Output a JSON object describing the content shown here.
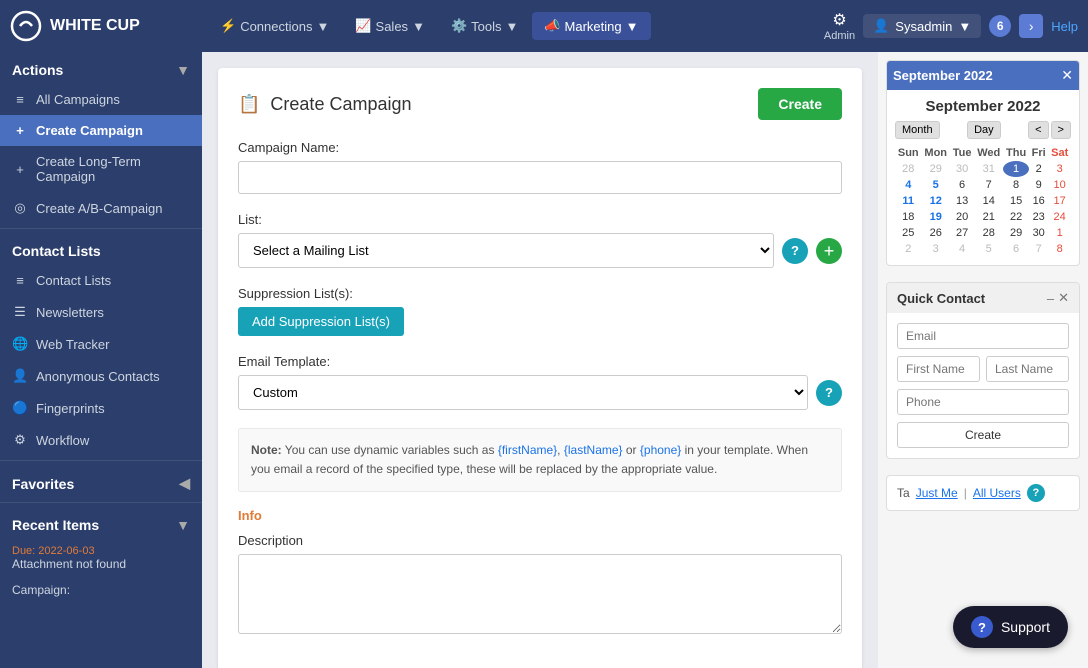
{
  "app": {
    "logo": "WHITE CUP",
    "nav": {
      "items": [
        {
          "id": "connections",
          "label": "Connections",
          "icon": "⚡",
          "active": false
        },
        {
          "id": "sales",
          "label": "Sales",
          "icon": "📈",
          "active": false
        },
        {
          "id": "tools",
          "label": "Tools",
          "icon": "⚙️",
          "active": false
        },
        {
          "id": "marketing",
          "label": "Marketing",
          "icon": "📣",
          "active": true
        }
      ],
      "admin_label": "Admin",
      "sysadmin_label": "Sysadmin",
      "badge_count": "6",
      "help_label": "Help"
    }
  },
  "sidebar": {
    "actions_label": "Actions",
    "items": [
      {
        "id": "all-campaigns",
        "label": "All Campaigns",
        "icon": "≡",
        "active": false
      },
      {
        "id": "create-campaign",
        "label": "Create Campaign",
        "icon": "+",
        "active": true
      },
      {
        "id": "create-longterm",
        "label": "Create Long-Term Campaign",
        "icon": "+",
        "active": false
      },
      {
        "id": "create-ab",
        "label": "Create A/B-Campaign",
        "icon": "◎",
        "active": false
      }
    ],
    "contact_lists_label": "Contact Lists",
    "contact_items": [
      {
        "id": "contact-lists",
        "label": "Contact Lists",
        "icon": "≡",
        "active": false
      },
      {
        "id": "newsletters",
        "label": "Newsletters",
        "icon": "☰",
        "active": false
      },
      {
        "id": "web-tracker",
        "label": "Web Tracker",
        "icon": "🌐",
        "active": false
      },
      {
        "id": "anonymous-contacts",
        "label": "Anonymous Contacts",
        "icon": "👤",
        "active": false
      },
      {
        "id": "fingerprints",
        "label": "Fingerprints",
        "icon": "🔵",
        "active": false
      },
      {
        "id": "workflow",
        "label": "Workflow",
        "icon": "⚙",
        "active": false
      }
    ],
    "favorites_label": "Favorites",
    "recent_items_label": "Recent Items",
    "recent": [
      {
        "due": "Due: 2022-06-03",
        "text": "Attachment not found"
      },
      {
        "label": "Campaign:",
        "value": ""
      }
    ]
  },
  "form": {
    "page_title": "Create Campaign",
    "create_button": "Create",
    "campaign_name_label": "Campaign Name:",
    "campaign_name_value": "",
    "list_label": "List:",
    "list_placeholder": "Select a Mailing List",
    "suppression_label": "Suppression List(s):",
    "suppression_button": "Add Suppression List(s)",
    "email_template_label": "Email Template:",
    "email_template_value": "Custom",
    "note_prefix": "Note:",
    "note_text": "You can use dynamic variables such as {firstName}, {lastName} or {phone} in your template. When you email a record of the specified type, these will be replaced by the appropriate value.",
    "info_label": "Info",
    "description_label": "Description",
    "description_value": ""
  },
  "calendar": {
    "header": "September 2022",
    "month_label": "September 2022",
    "month_btn": "Month",
    "day_btn": "Day",
    "days_of_week": [
      "Sun",
      "Mon",
      "Tue",
      "Wed",
      "Thu",
      "Fri",
      "Sat"
    ],
    "weeks": [
      [
        "28",
        "29",
        "30",
        "31",
        "1",
        "2",
        "3"
      ],
      [
        "4",
        "5",
        "6",
        "7",
        "8",
        "9",
        "10"
      ],
      [
        "11",
        "12",
        "13",
        "14",
        "15",
        "16",
        "17"
      ],
      [
        "18",
        "19",
        "20",
        "21",
        "22",
        "23",
        "24"
      ],
      [
        "25",
        "26",
        "27",
        "28",
        "29",
        "30",
        "1"
      ],
      [
        "2",
        "3",
        "4",
        "5",
        "6",
        "7",
        "8"
      ]
    ],
    "highlights": [
      "1",
      "11",
      "12",
      "19"
    ],
    "today_date": "1",
    "other_month_start": [
      "28",
      "29",
      "30",
      "31"
    ],
    "other_month_end": [
      "1",
      "2",
      "3",
      "4",
      "5",
      "6",
      "7",
      "8"
    ]
  },
  "quick_contact": {
    "title": "Quick Contact",
    "email_placeholder": "Email",
    "first_name_placeholder": "First Name",
    "last_name_placeholder": "Last Name",
    "phone_placeholder": "Phone",
    "create_button": "Create"
  },
  "tags": {
    "label": "Ta",
    "links": [
      "Just Me",
      "All Users"
    ],
    "help_icon": "?"
  },
  "support": {
    "label": "Support",
    "icon": "?"
  }
}
